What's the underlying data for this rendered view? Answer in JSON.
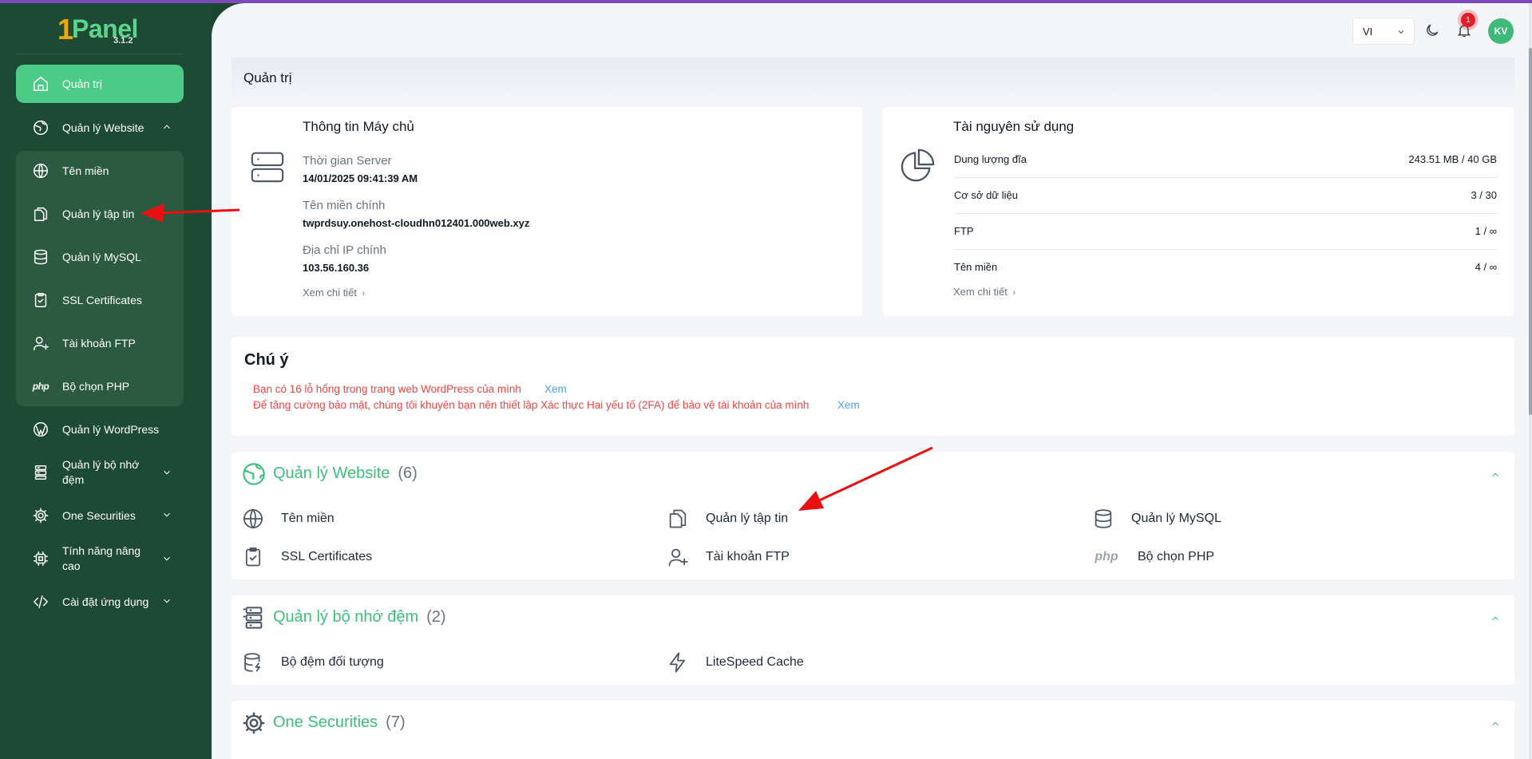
{
  "app": {
    "logo_panel": "Panel",
    "logo_one": "1",
    "version": "3.1.2"
  },
  "sidebar": {
    "dashboard": "Quản trị",
    "website_mgmt": "Quản lý Website",
    "sub": {
      "domains": "Tên miền",
      "file_manager": "Quản lý tập tin",
      "mysql": "Quản lý MySQL",
      "ssl": "SSL Certificates",
      "ftp": "Tài khoản FTP",
      "php": "Bộ chọn PHP",
      "php_glyph": "php"
    },
    "wordpress": "Quản lý WordPress",
    "cache": "Quản lý bộ nhớ đệm",
    "securities": "One Securities",
    "advanced": "Tính năng nâng cao",
    "apps": "Cài đặt ứng dụng"
  },
  "topbar": {
    "language": "VI",
    "notification_count": "1",
    "avatar_initials": "KV"
  },
  "page": {
    "title": "Quản trị"
  },
  "server_info": {
    "title": "Thông tin Máy chủ",
    "time_label": "Thời gian Server",
    "time_value": "14/01/2025 09:41:39 AM",
    "domain_label": "Tên miền chính",
    "domain_value": "twprdsuy.onehost-cloudhn012401.000web.xyz",
    "ip_label": "Địa chỉ IP chính",
    "ip_value": "103.56.160.36",
    "more": "Xem chi tiết"
  },
  "resources": {
    "title": "Tài nguyên sử dụng",
    "rows": [
      {
        "label": "Dung lượng đĩa",
        "value": "243.51 MB / 40 GB"
      },
      {
        "label": "Cơ sở dữ liệu",
        "value": "3 / 30"
      },
      {
        "label": "FTP",
        "value": "1 / ∞"
      },
      {
        "label": "Tên miền",
        "value": "4 / ∞"
      }
    ],
    "more": "Xem chi tiết"
  },
  "notice": {
    "title": "Chú ý",
    "line1": "Bạn có 16 lỗ hổng trong trang web WordPress của mình",
    "line2": "Để tăng cường bảo mật, chúng tôi khuyên bạn nên thiết lập Xác thực Hai yếu tố (2FA) để bảo vệ tài khoản của mình",
    "link": "Xem"
  },
  "sections": {
    "website": {
      "title": "Quản lý Website",
      "count": "(6)",
      "items": {
        "domains": "Tên miền",
        "files": "Quản lý tập tin",
        "mysql": "Quản lý MySQL",
        "ssl": "SSL Certificates",
        "ftp": "Tài khoản FTP",
        "php": "Bộ chọn PHP",
        "php_glyph": "php"
      }
    },
    "cache": {
      "title": "Quản lý bộ nhớ đệm",
      "count": "(2)",
      "items": {
        "object": "Bộ đệm đối tượng",
        "litespeed": "LiteSpeed Cache"
      }
    },
    "securities": {
      "title": "One Securities",
      "count": "(7)"
    }
  },
  "colors": {
    "sidebar_bg": "#1d4a33",
    "accent": "#4bcb86",
    "alert": "#ef4444",
    "link": "#4aa3e8",
    "annotation": "#e81010"
  }
}
